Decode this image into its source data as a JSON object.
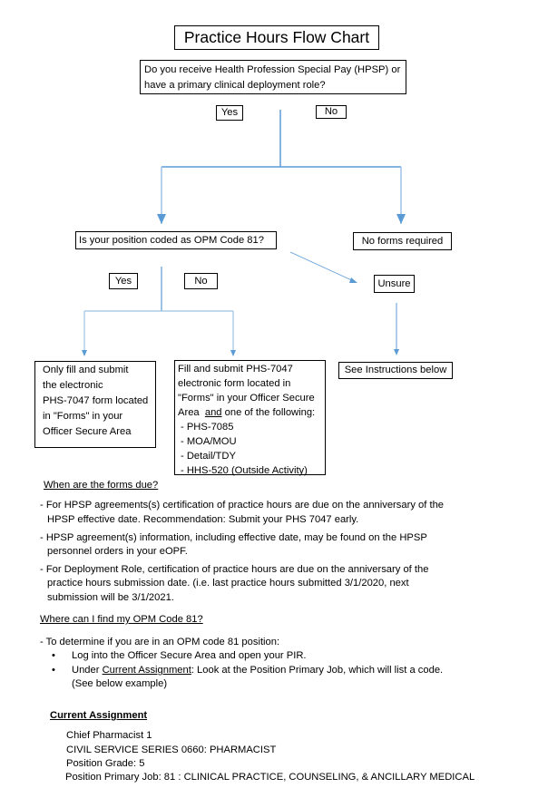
{
  "title": "Practice Hours Flow Chart",
  "flowchart": {
    "question1": {
      "lines": [
        "Do you receive Health Profession Special Pay (HPSP) or",
        "have a primary clinical deployment role?"
      ],
      "yes_label": "Yes",
      "no_label": "No"
    },
    "question2": {
      "text": "Is your position coded as OPM Code 81?",
      "yes_label": "Yes",
      "no_label": "No"
    },
    "no_forms": "No forms required",
    "unsure": "Unsure",
    "see_instructions": "See Instructions below",
    "only_fill": {
      "lines": [
        "Only fill and submit",
        "the electronic",
        "PHS-7047 form located",
        "in \"Forms\" in your",
        "Officer Secure Area"
      ]
    },
    "fill_and_submit": {
      "lines": [
        "Fill and submit PHS-7047",
        "electronic form located in",
        "\"Forms\" in your Officer Secure"
      ],
      "area_prefix": "Area",
      "and_word": "and",
      "area_suffix": "one of the following:",
      "items": [
        "- PHS-7085",
        "- MOA/MOU",
        "- Detail/TDY",
        "- HHS-520 (Outside Activity)"
      ]
    },
    "arrow_color": "#5b9bd5"
  },
  "due_section": {
    "heading": "When are the forms due?",
    "items": [
      {
        "lines": [
          "- For HPSP agreements(s) certification of practice hours are due on the anniversary of the",
          "HPSP effective date.  Recommendation: Submit your PHS 7047 early."
        ]
      },
      {
        "lines": [
          "- HPSP agreement(s) information, including effective date, may be found on the HPSP",
          "personnel orders in your eOPF."
        ]
      },
      {
        "lines": [
          "- For Deployment Role, certification of practice hours are due on the anniversary of the",
          "practice hours submission date.  (i.e. last practice hours submitted 3/1/2020, next",
          "submission will be 3/1/2021."
        ]
      }
    ]
  },
  "opm_section": {
    "heading": "Where can I find my OPM Code 81?",
    "intro": "- To determine if you are in an OPM code 81 position:",
    "bullet_char": "•",
    "bullet1": "Log into the Officer Secure Area and open your PIR.",
    "bullet2_prefix": "Under",
    "bullet2_link": "Current Assignment",
    "bullet2_suffix": ": Look at the Position Primary Job, which will list a code.",
    "bullet2_line2": "(See below example)"
  },
  "example": {
    "heading": "Current Assignment",
    "lines": [
      "Chief Pharmacist 1",
      "CIVIL SERVICE SERIES 0660: PHARMACIST",
      "Position Grade: 5",
      "Position Primary Job: 81 : CLINICAL PRACTICE, COUNSELING, & ANCILLARY MEDICAL"
    ]
  }
}
